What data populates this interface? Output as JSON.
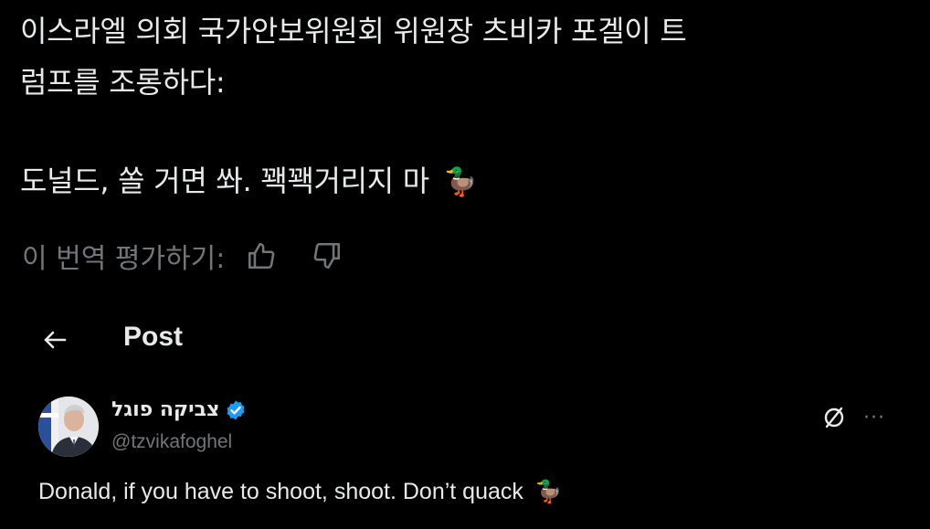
{
  "translation": {
    "line1": "이스라엘 의회 국가안보위원회 위원장 츠비카 포겔이 트",
    "line2": "럼프를 조롱하다:",
    "line3": "도널드, 쏠 거면 쏴. 꽥꽥거리지 마",
    "line3_emoji": "🦆",
    "rate_label": "이 번역 평가하기:"
  },
  "icons": {
    "thumbs_up": "thumbs-up-icon",
    "thumbs_down": "thumbs-down-icon",
    "back": "arrow-left-icon",
    "verified": "verified-badge-icon",
    "grok": "grok-icon",
    "more": "more-dots-icon"
  },
  "header": {
    "title": "Post"
  },
  "post": {
    "author_name": "צביקה פוגל",
    "author_handle": "@tzvikafoghel",
    "text": "Donald, if you have to shoot, shoot. Don’t quack",
    "text_emoji": "🦆",
    "more_glyph": "···"
  },
  "colors": {
    "background": "#000000",
    "text_primary": "#e7e9ea",
    "text_secondary": "#71767b",
    "verified_blue": "#1d9bf0"
  }
}
